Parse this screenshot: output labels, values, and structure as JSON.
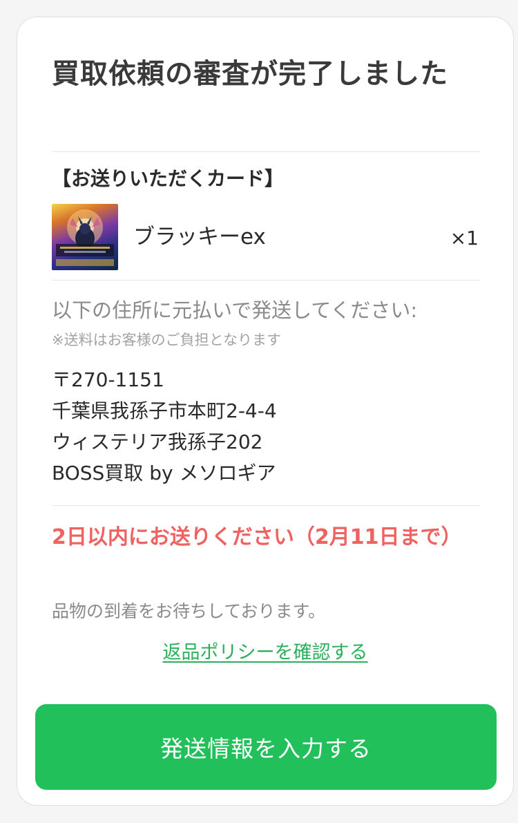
{
  "review": {
    "title": "買取依頼の審査が完了しました"
  },
  "send_cards": {
    "section_label": "【お送りいただくカード】",
    "items": [
      {
        "name": "ブラッキーex",
        "quantity": "×1"
      }
    ]
  },
  "shipping": {
    "instruction": "以下の住所に元払いで発送してください:",
    "note": "※送料はお客様のご負担となります",
    "address_lines": [
      "〒270-1151",
      "千葉県我孫子市本町2-4-4",
      "ウィステリア我孫子202",
      "BOSS買取 by メソロギア"
    ]
  },
  "deadline": {
    "text": "2日以内にお送りください（2月11日まで）",
    "color": "#ef6262"
  },
  "waiting_message": "品物の到着をお待ちしております。",
  "return_policy_link": "返品ポリシーを確認する",
  "submit_button_label": "発送情報を入力する",
  "colors": {
    "accent": "#21c05a",
    "link": "#2aaf5a"
  },
  "icons": {
    "card_thumbnail": "pokemon-card-thumbnail"
  }
}
